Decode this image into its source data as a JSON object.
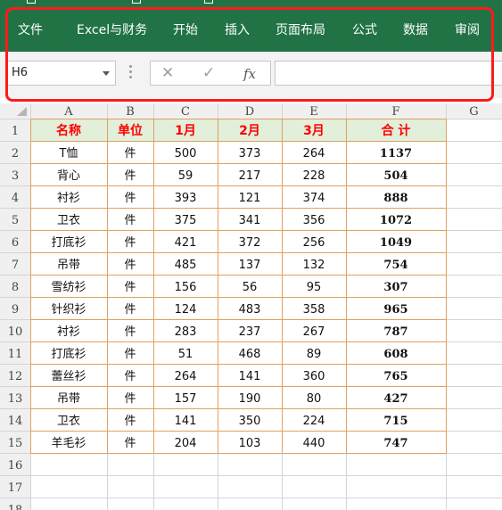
{
  "ribbon": {
    "tabs": [
      "文件",
      "Excel与财务",
      "开始",
      "插入",
      "页面布局",
      "公式",
      "数据",
      "审阅"
    ]
  },
  "formula_bar": {
    "name_box": "H6",
    "cancel_icon": "✕",
    "enter_icon": "✓",
    "function_label": "fx",
    "formula_value": ""
  },
  "sheet": {
    "columns": [
      "A",
      "B",
      "C",
      "D",
      "E",
      "F",
      "G"
    ],
    "row_numbers": [
      "1",
      "2",
      "3",
      "4",
      "5",
      "6",
      "7",
      "8",
      "9",
      "10",
      "11",
      "12",
      "13",
      "14",
      "15",
      "16",
      "17",
      "18"
    ],
    "header": [
      "名称",
      "单位",
      "1月",
      "2月",
      "3月",
      "合 计"
    ],
    "rows": [
      [
        "T恤",
        "件",
        "500",
        "373",
        "264",
        "1137"
      ],
      [
        "背心",
        "件",
        "59",
        "217",
        "228",
        "504"
      ],
      [
        "衬衫",
        "件",
        "393",
        "121",
        "374",
        "888"
      ],
      [
        "卫衣",
        "件",
        "375",
        "341",
        "356",
        "1072"
      ],
      [
        "打底衫",
        "件",
        "421",
        "372",
        "256",
        "1049"
      ],
      [
        "吊带",
        "件",
        "485",
        "137",
        "132",
        "754"
      ],
      [
        "雪纺衫",
        "件",
        "156",
        "56",
        "95",
        "307"
      ],
      [
        "针织衫",
        "件",
        "124",
        "483",
        "358",
        "965"
      ],
      [
        "衬衫",
        "件",
        "283",
        "237",
        "267",
        "787"
      ],
      [
        "打底衫",
        "件",
        "51",
        "468",
        "89",
        "608"
      ],
      [
        "蕾丝衫",
        "件",
        "264",
        "141",
        "360",
        "765"
      ],
      [
        "吊带",
        "件",
        "157",
        "190",
        "80",
        "427"
      ],
      [
        "卫衣",
        "件",
        "141",
        "350",
        "224",
        "715"
      ],
      [
        "羊毛衫",
        "件",
        "204",
        "103",
        "440",
        "747"
      ]
    ]
  },
  "colors": {
    "ribbon": "#217346",
    "highlight": "#ff1a1a",
    "table_header_fill": "#e2efda",
    "table_header_text": "#ff0000",
    "table_border": "#e0a060"
  }
}
